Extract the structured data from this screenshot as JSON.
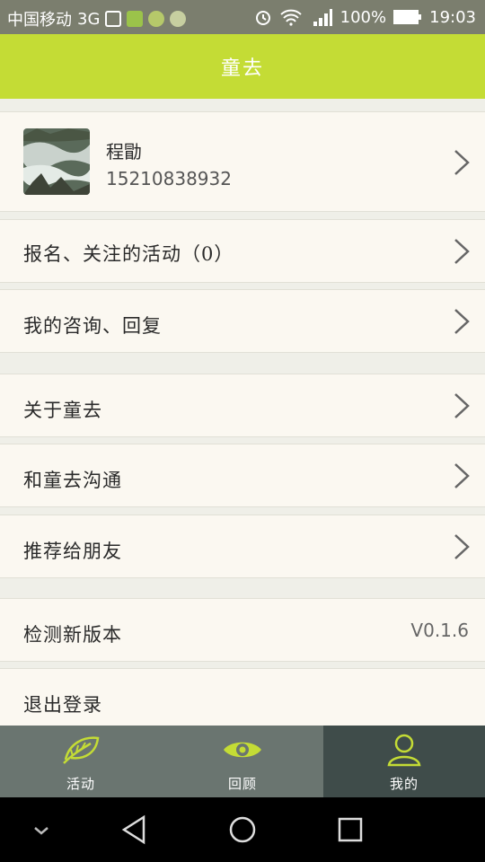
{
  "status": {
    "carrier": "中国移动",
    "network": "3G",
    "battery": "100%",
    "time": "19:03"
  },
  "header": {
    "title": "童去"
  },
  "profile": {
    "name": "程勖",
    "phone": "15210838932"
  },
  "menu": {
    "activities": "报名、关注的活动（0）",
    "consult": "我的咨询、回复",
    "about": "关于童去",
    "contact": "和童去沟通",
    "recommend": "推荐给朋友",
    "update": "检测新版本",
    "version": "V0.1.6",
    "logout": "退出登录"
  },
  "tabs": [
    {
      "label": "活动",
      "icon": "leaf-icon"
    },
    {
      "label": "回顾",
      "icon": "eye-icon"
    },
    {
      "label": "我的",
      "icon": "user-icon"
    }
  ],
  "active_tab": 2,
  "colors": {
    "header": "#c4dc35",
    "accent": "#c4dc35",
    "tabbar": "#6a7570",
    "tab_active": "#3f4c4a"
  }
}
